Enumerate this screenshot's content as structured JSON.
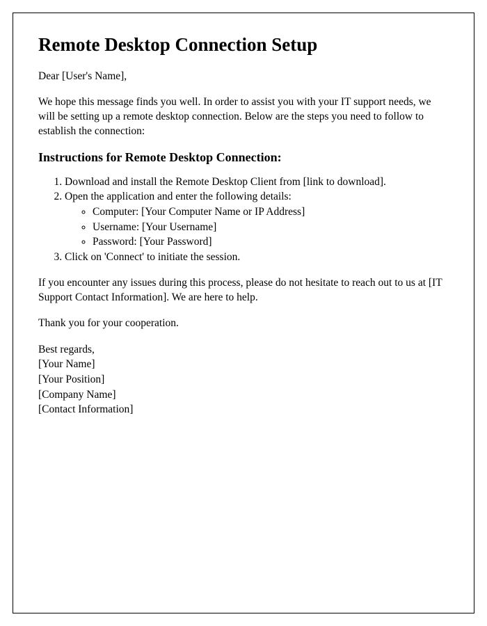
{
  "title": "Remote Desktop Connection Setup",
  "greeting": "Dear [User's Name],",
  "intro": "We hope this message finds you well. In order to assist you with your IT support needs, we will be setting up a remote desktop connection. Below are the steps you need to follow to establish the connection:",
  "instructions_heading": "Instructions for Remote Desktop Connection:",
  "steps": {
    "step1": "Download and install the Remote Desktop Client from [link to download].",
    "step2": "Open the application and enter the following details:",
    "details": {
      "computer": "Computer: [Your Computer Name or IP Address]",
      "username": "Username: [Your Username]",
      "password": "Password: [Your Password]"
    },
    "step3": "Click on 'Connect' to initiate the session."
  },
  "support": "If you encounter any issues during this process, please do not hesitate to reach out to us at [IT Support Contact Information]. We are here to help.",
  "thanks": "Thank you for your cooperation.",
  "signature": {
    "closing": "Best regards,",
    "name": "[Your Name]",
    "position": "[Your Position]",
    "company": "[Company Name]",
    "contact": "[Contact Information]"
  }
}
